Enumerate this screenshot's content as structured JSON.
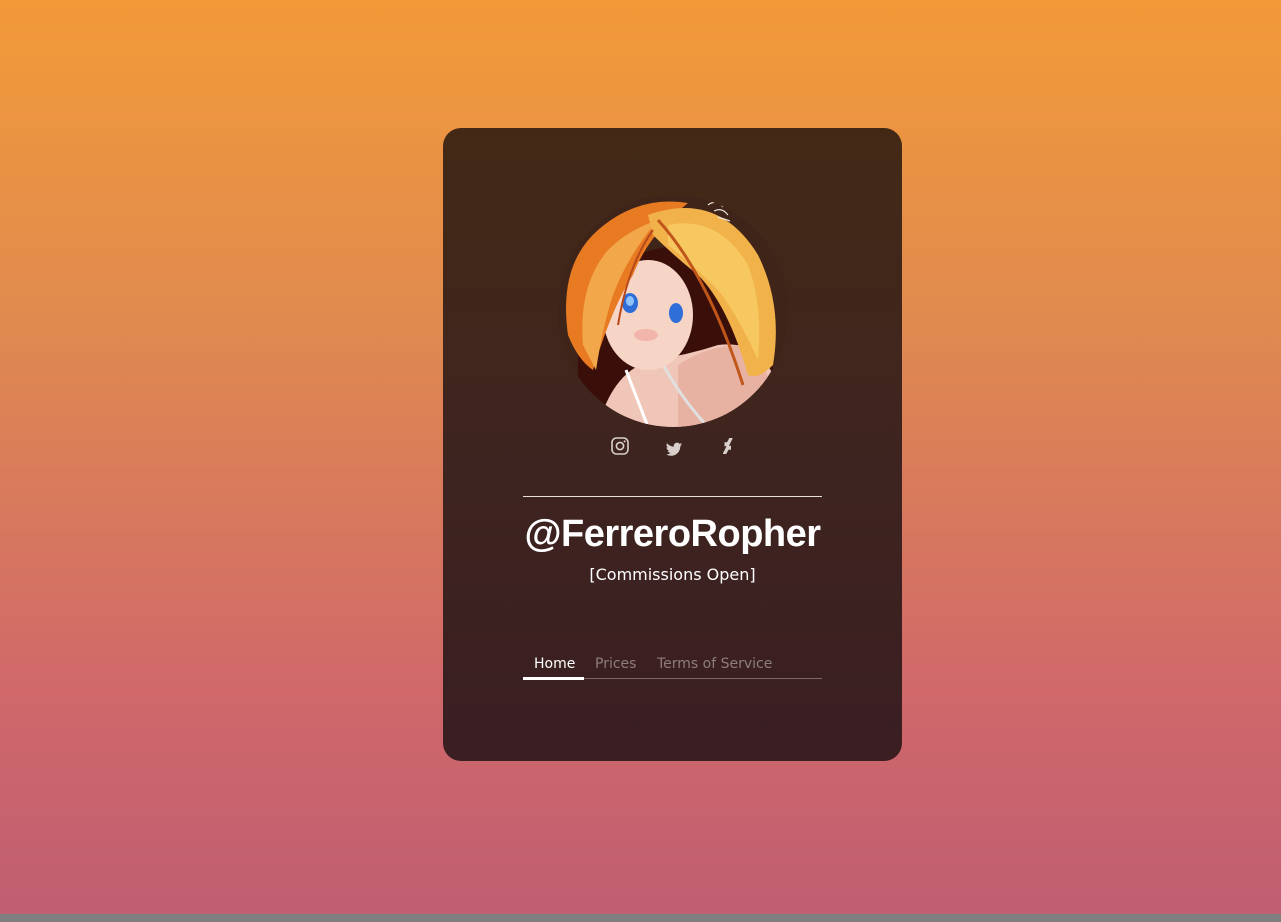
{
  "profile": {
    "handle": "@FerreroRopher",
    "status": "[Commissions Open]",
    "avatar_alt": "avatar"
  },
  "socials": [
    {
      "icon": "instagram-icon"
    },
    {
      "icon": "twitter-icon"
    },
    {
      "icon": "deviantart-icon"
    }
  ],
  "tabs": [
    {
      "label": "Home",
      "active": true
    },
    {
      "label": "Prices",
      "active": false
    },
    {
      "label": "Terms of Service",
      "active": false
    }
  ],
  "colors": {
    "bg_top": "#f29a38",
    "bg_bottom": "#bf5e72",
    "card": "#3f2419",
    "text": "#ffffff",
    "tab_inactive": "#8d7e7a"
  }
}
